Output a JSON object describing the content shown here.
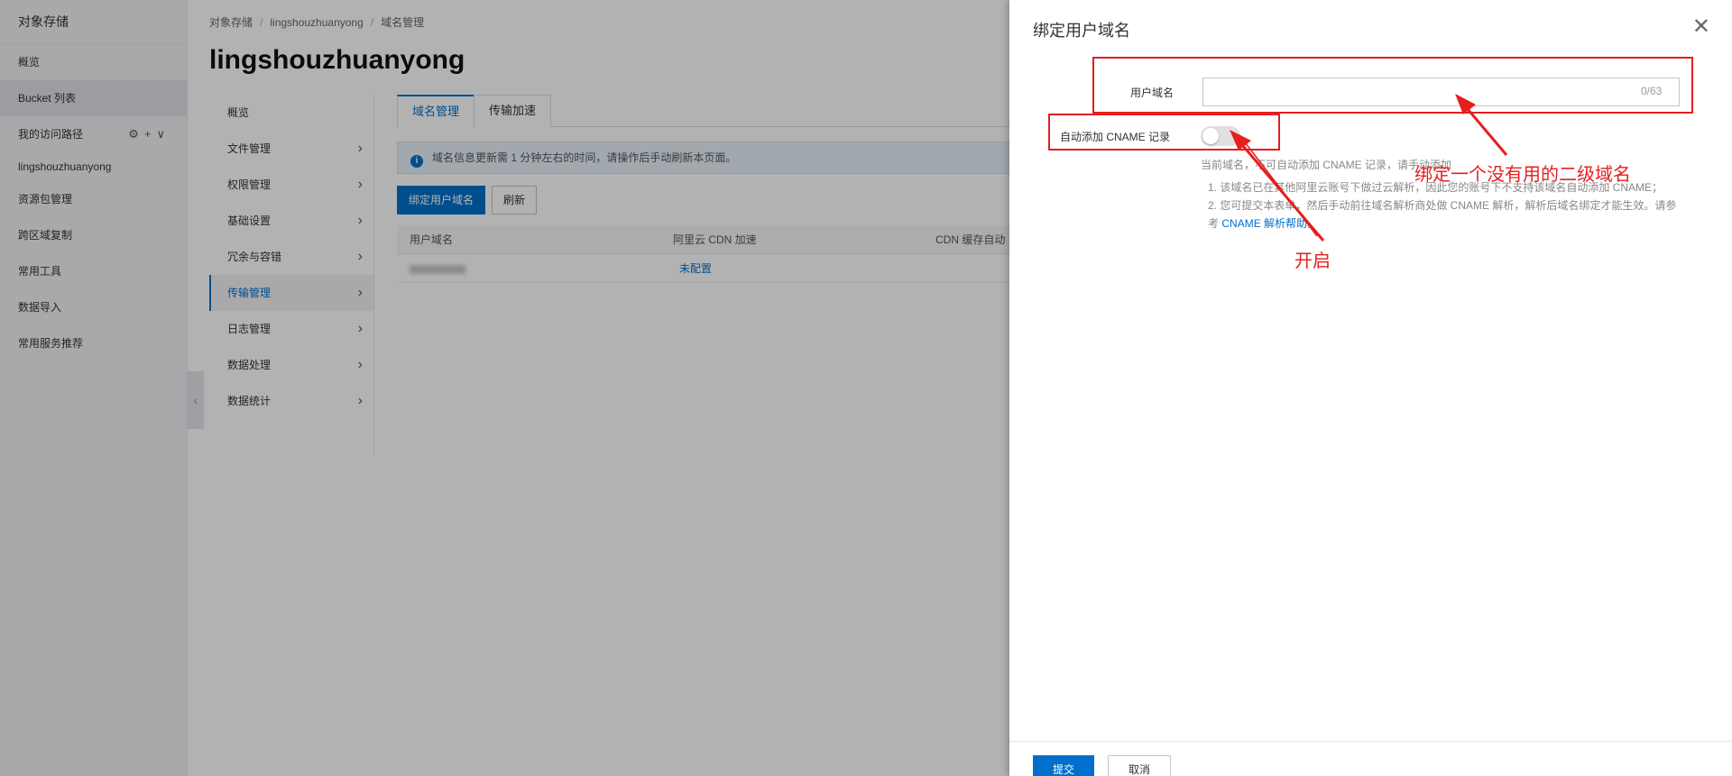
{
  "console": {
    "nav_title": "对象存储",
    "nav_items": [
      "概览",
      "Bucket 列表",
      "我的访问路径",
      "lingshouzhuanyong",
      "资源包管理",
      "跨区域复制",
      "常用工具",
      "数据导入",
      "常用服务推荐"
    ],
    "path_icons": "⚙+∨",
    "breadcrumb": [
      "对象存储",
      "lingshouzhuanyong",
      "域名管理"
    ],
    "bucket_title": "lingshouzhuanyong",
    "sub_nav": [
      "概览",
      "文件管理",
      "权限管理",
      "基础设置",
      "冗余与容错",
      "传输管理",
      "日志管理",
      "数据处理",
      "数据统计"
    ],
    "tabs": [
      "域名管理",
      "传输加速"
    ],
    "info_text": "域名信息更新需 1 分钟左右的时间，请操作后手动刷新本页面。",
    "bind_button": "绑定用户域名",
    "refresh_button": "刷新",
    "columns": [
      "用户域名",
      "阿里云 CDN 加速",
      "CDN 缓存自动"
    ],
    "row_status": "未配置",
    "collapse_icon": "chevron-left-icon"
  },
  "drawer": {
    "title": "绑定用户域名",
    "domain_label": "用户域名",
    "domain_value": "",
    "domain_placeholder": "",
    "domain_counter": "0/63",
    "auto_cname_label": "自动添加 CNAME 记录",
    "auto_cname_enabled": false,
    "hint": "当前域名，不可自动添加 CNAME 记录，请手动添加",
    "hint_items": [
      "1. 该域名已在其他阿里云账号下做过云解析，因此您的账号下不支持该域名自动添加 CNAME；",
      "2. 您可提交本表单，然后手动前往域名解析商处做 CNAME 解析，解析后域名绑定才能生效。请参考",
      "CNAME 解析帮助",
      "。"
    ],
    "submit": "提交",
    "cancel": "取消"
  },
  "annotations": {
    "domain_note": "绑定一个没有用的二级域名",
    "toggle_note": "开启",
    "color": "#e61e1e"
  }
}
